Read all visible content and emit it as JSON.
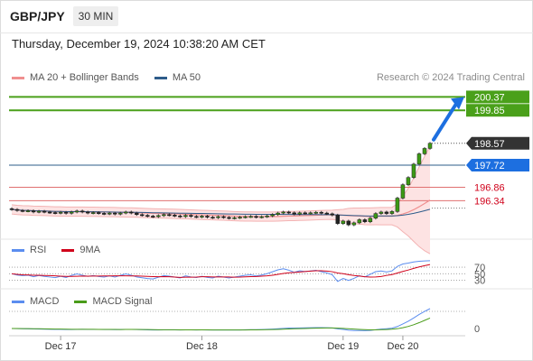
{
  "header": {
    "pair": "GBP/JPY",
    "timeframe": "30 MIN"
  },
  "date_line": "Thursday, December 19, 2024 10:38:20 AM CET",
  "legends": {
    "main": [
      {
        "label": "MA 20 + Bollinger Bands",
        "color": "#f08f8f"
      },
      {
        "label": "MA 50",
        "color": "#2e5c8a"
      }
    ],
    "rsi": [
      {
        "label": "RSI",
        "color": "#5b8def"
      },
      {
        "label": "9MA",
        "color": "#d0021b"
      }
    ],
    "macd": [
      {
        "label": "MACD",
        "color": "#5b8def"
      },
      {
        "label": "MACD Signal",
        "color": "#4a9c1a"
      }
    ]
  },
  "credit": "Research © 2024 Trading Central",
  "colors": {
    "green": "#4aa01a",
    "blue": "#1d6fe0",
    "red": "#d0021b",
    "dark": "#333333",
    "ma50": "#2e5c8a",
    "band": "#fde3e3"
  },
  "chart_data": {
    "type": "line",
    "price_panel": {
      "ylim": [
        194.95,
        200.7
      ],
      "levels": [
        {
          "value": 200.37,
          "label": "200.37",
          "kind": "resistance",
          "color": "#4aa01a"
        },
        {
          "value": 199.85,
          "label": "199.85",
          "kind": "resistance",
          "color": "#4aa01a"
        },
        {
          "value": 198.57,
          "label": "198.57",
          "kind": "last",
          "color": "#333333"
        },
        {
          "value": 197.72,
          "label": "197.72",
          "kind": "pivot",
          "color": "#1d6fe0"
        },
        {
          "value": 196.86,
          "label": "196.86",
          "kind": "support",
          "color": "#d0021b"
        },
        {
          "value": 196.34,
          "label": "196.34",
          "kind": "support",
          "color": "#d0021b"
        }
      ],
      "close": [
        196.0,
        195.96,
        195.94,
        195.95,
        195.9,
        195.93,
        195.9,
        195.88,
        195.86,
        195.89,
        195.85,
        195.9,
        195.94,
        195.9,
        195.86,
        195.88,
        195.85,
        195.83,
        195.86,
        195.82,
        195.86,
        195.9,
        195.86,
        195.8,
        195.77,
        195.74,
        195.72,
        195.76,
        195.8,
        195.78,
        195.75,
        195.72,
        195.77,
        195.73,
        195.71,
        195.74,
        195.7,
        195.68,
        195.72,
        195.69,
        195.66,
        195.68,
        195.7,
        195.72,
        195.73,
        195.7,
        195.72,
        195.75,
        195.8,
        195.86,
        195.9,
        195.87,
        195.82,
        195.87,
        195.85,
        195.87,
        195.89,
        195.86,
        195.83,
        195.78,
        195.45,
        195.55,
        195.4,
        195.48,
        195.6,
        195.52,
        195.66,
        195.84,
        195.9,
        195.84,
        195.92,
        196.44,
        196.96,
        197.24,
        197.76,
        198.16,
        198.37,
        198.57
      ],
      "x_ticks": [
        {
          "label": "Dec 17",
          "index": 9
        },
        {
          "label": "Dec 18",
          "index": 35
        },
        {
          "label": "Dec 19",
          "index": 61
        },
        {
          "label": "Dec 20",
          "index": 72
        }
      ],
      "projection": {
        "from": 198.57,
        "to": 200.37
      }
    },
    "rsi_panel": {
      "ylim": [
        15,
        95
      ],
      "levels": [
        70,
        50,
        30
      ],
      "level_labels": [
        "70",
        "50",
        "30"
      ]
    },
    "macd_panel": {
      "zero_label": "0"
    }
  }
}
